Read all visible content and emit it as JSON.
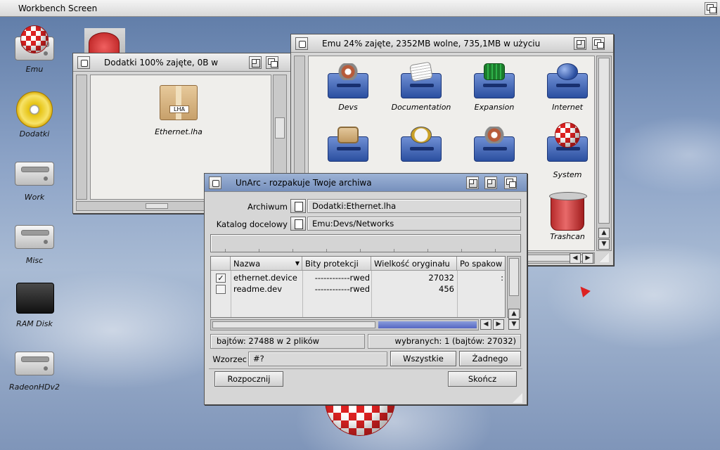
{
  "screen": {
    "title": "Workbench Screen"
  },
  "desktop_icons": [
    {
      "label": "Emu",
      "icon": "boing-ball-drive-icon"
    },
    {
      "label": "Dodatki",
      "icon": "cd-icon"
    },
    {
      "label": "Work",
      "icon": "hard-drive-icon"
    },
    {
      "label": "Misc",
      "icon": "hard-drive-icon"
    },
    {
      "label": "RAM Disk",
      "icon": "ram-disk-icon"
    },
    {
      "label": "RadeonHDv2",
      "icon": "hard-drive-icon"
    }
  ],
  "dodatki_window": {
    "title": "Dodatki  100% zajęte, 0B w",
    "items": [
      {
        "label": "Ethernet.lha",
        "icon": "archive-box-icon",
        "badge": "LHA"
      }
    ]
  },
  "emu_window": {
    "title": "Emu  24% zajęte, 2352MB wolne, 735,1MB w użyciu",
    "items": [
      {
        "label": "Devs",
        "icon": "drawer-gears-icon"
      },
      {
        "label": "Documentation",
        "icon": "drawer-documents-icon"
      },
      {
        "label": "Expansion",
        "icon": "drawer-circuit-board-icon"
      },
      {
        "label": "Internet",
        "icon": "drawer-globe-icon"
      },
      {
        "label": "",
        "icon": "drawer-window-icon"
      },
      {
        "label": "",
        "icon": "drawer-clock-icon"
      },
      {
        "label": "",
        "icon": "drawer-gears-icon"
      },
      {
        "label": "System",
        "icon": "drawer-boing-ball-icon"
      },
      {
        "label": "Trashcan",
        "icon": "trashcan-icon"
      }
    ]
  },
  "unarc": {
    "title": "UnArc - rozpakuje Twoje archiwa",
    "archive_label": "Archiwum",
    "archive_value": "Dodatki:Ethernet.lha",
    "dest_label": "Katalog docelowy",
    "dest_value": "Emu:Devs/Networks",
    "columns": [
      "Nazwa",
      "Bity protekcji",
      "Wielkość oryginału",
      "Po spakow"
    ],
    "rows": [
      {
        "checked": true,
        "check_mark": "✓",
        "name": "ethernet.device",
        "prot": "------------rwed",
        "size": "27032",
        "packed": ":"
      },
      {
        "checked": false,
        "check_mark": "",
        "name": "readme.dev",
        "prot": "------------rwed",
        "size": "456",
        "packed": ""
      }
    ],
    "status_total": "bajtów: 27488 w 2 plików",
    "status_selected": "wybranych: 1 (bajtów: 27032)",
    "pattern_label": "Wzorzec",
    "pattern_value": "#?",
    "select_all": "Wszystkie",
    "select_none": "Żadnego",
    "start": "Rozpocznij",
    "quit": "Skończ"
  }
}
